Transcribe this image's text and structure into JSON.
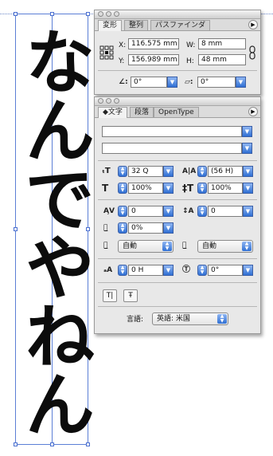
{
  "canvas": {
    "vertical_text": "なんでやねん"
  },
  "transform_panel": {
    "tabs": [
      "変形",
      "整列",
      "パスファインダ"
    ],
    "x_label": "X:",
    "x_value": "116.575 mm",
    "y_label": "Y:",
    "y_value": "156.989 mm",
    "w_label": "W:",
    "w_value": "8 mm",
    "h_label": "H:",
    "h_value": "48 mm",
    "rotate_value": "0°",
    "shear_value": "0°"
  },
  "character_panel": {
    "tabs": [
      "文字",
      "段落",
      "OpenType"
    ],
    "font_family": "",
    "font_style": "",
    "font_size": "32 Q",
    "leading": "(56 H)",
    "vertical_scale": "100%",
    "horizontal_scale": "100%",
    "kerning": "0",
    "tracking": "0",
    "tsume": "0%",
    "aki_left": "自動",
    "aki_right": "自動",
    "baseline_shift": "0 H",
    "char_rotation": "0°",
    "language_label": "言語:",
    "language_value": "英語: 米国"
  },
  "icons": {
    "reference_point": "reference-point-grid-icon",
    "link": "constrain-proportions-icon",
    "rotate": "rotate-icon",
    "shear": "shear-icon"
  }
}
